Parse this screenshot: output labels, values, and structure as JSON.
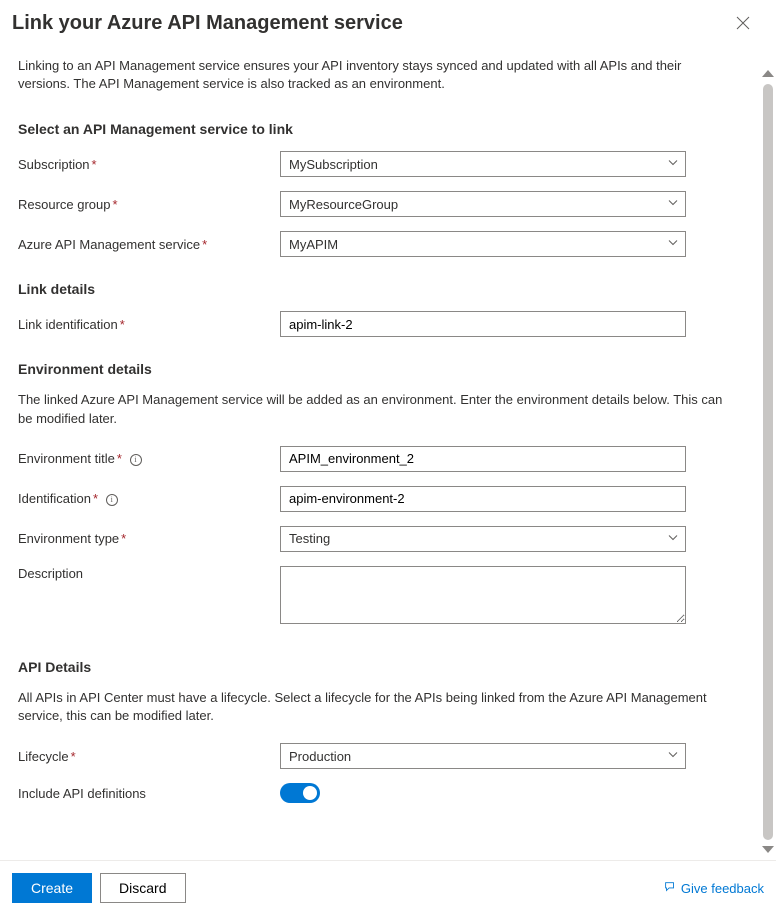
{
  "header": {
    "title": "Link your Azure API Management service"
  },
  "intro": "Linking to an API Management service ensures your API inventory stays synced and updated with all APIs and their versions. The API Management service is also tracked as an environment.",
  "sections": {
    "select": {
      "heading": "Select an API Management service to link",
      "subscription": {
        "label": "Subscription",
        "value": "MySubscription"
      },
      "resource_group": {
        "label": "Resource group",
        "value": "MyResourceGroup"
      },
      "apim_service": {
        "label": "Azure API Management service",
        "value": "MyAPIM"
      }
    },
    "link_details": {
      "heading": "Link details",
      "link_id": {
        "label": "Link identification",
        "value": "apim-link-2"
      }
    },
    "env_details": {
      "heading": "Environment details",
      "subtext": "The linked Azure API Management service will be added as an environment. Enter the environment details below. This can be modified later.",
      "env_title": {
        "label": "Environment title",
        "value": "APIM_environment_2"
      },
      "identification": {
        "label": "Identification",
        "value": "apim-environment-2"
      },
      "env_type": {
        "label": "Environment type",
        "value": "Testing"
      },
      "description": {
        "label": "Description",
        "value": ""
      }
    },
    "api_details": {
      "heading": "API Details",
      "subtext": "All APIs in API Center must have a lifecycle. Select a lifecycle for the APIs being linked from the Azure API Management service, this can be modified later.",
      "lifecycle": {
        "label": "Lifecycle",
        "value": "Production"
      },
      "include_defs": {
        "label": "Include API definitions",
        "enabled": true
      }
    }
  },
  "footer": {
    "create": "Create",
    "discard": "Discard",
    "feedback": "Give feedback"
  }
}
